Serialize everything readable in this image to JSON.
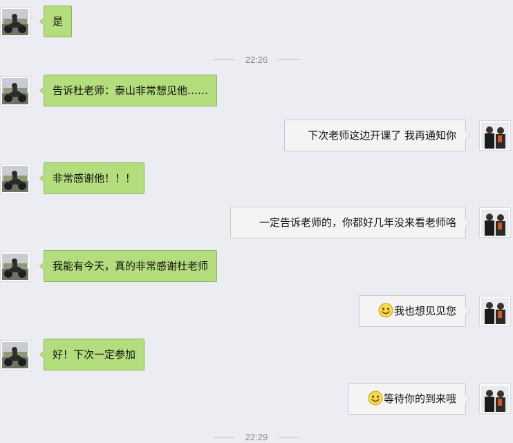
{
  "avatars": {
    "contact": "contact-avatar-motorcycle",
    "self": "self-avatar-two-people"
  },
  "emoji": "smiley-face-icon",
  "timestamps": [
    "22:26",
    "22:29"
  ],
  "messages": [
    {
      "side": "left",
      "text": "是"
    },
    {
      "side": "left",
      "text": "告诉杜老师：泰山非常想见他……"
    },
    {
      "side": "right",
      "text": "下次老师这边开课了 我再通知你"
    },
    {
      "side": "left",
      "text": "非常感谢他！！！"
    },
    {
      "side": "right",
      "text": "一定告诉老师的，你都好几年没来看老师咯"
    },
    {
      "side": "left",
      "text": "我能有今天，真的非常感谢杜老师"
    },
    {
      "side": "right",
      "text": "我也想见见您"
    },
    {
      "side": "left",
      "text": "好！下次一定参加"
    },
    {
      "side": "right",
      "text": "等待你的到来哦"
    }
  ]
}
